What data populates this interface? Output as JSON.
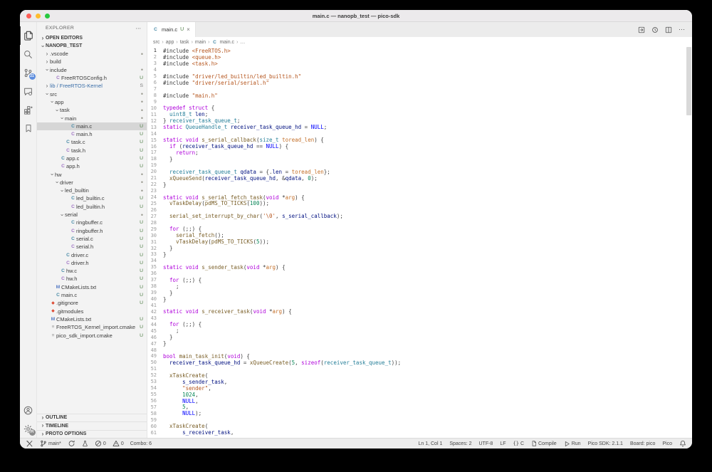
{
  "colors": {
    "keyword": "#AF00DB",
    "type": "#267F99",
    "function": "#795E26",
    "variable": "#001080",
    "string": "#B5551D",
    "number": "#098658",
    "constant": "#0000FF",
    "parameter": "#C4702A",
    "default": "#3B3B3B",
    "badge_untracked": "#518048",
    "badge_blue": "#2E6FD9",
    "icon_c_file": "#498BA7",
    "icon_h_file": "#A074C4",
    "icon_cmake": "#5277C3",
    "icon_git": "#DD4C35",
    "traffic_red": "#FF5F57",
    "traffic_yellow": "#FEBC2E",
    "traffic_green": "#28C840",
    "submodule_label": "#3A6EA8"
  },
  "window": {
    "title": "main.c — nanopb_test — pico-sdk"
  },
  "activity_bar": {
    "top": [
      {
        "icon": "explorer",
        "active": true
      },
      {
        "icon": "search",
        "active": false
      },
      {
        "icon": "source-control",
        "active": false,
        "badge": "21"
      },
      {
        "icon": "chat",
        "active": false
      },
      {
        "icon": "extensions",
        "active": false
      },
      {
        "icon": "bookmarks",
        "active": false
      }
    ],
    "bottom": [
      {
        "icon": "account"
      },
      {
        "icon": "settings",
        "badge": "PI"
      }
    ]
  },
  "sidebar": {
    "title": "EXPLORER",
    "more_label": "⋯",
    "open_editors_label": "OPEN EDITORS",
    "root_label": "NANOPB_TEST",
    "tree": [
      {
        "d": 0,
        "folder": true,
        "open": false,
        "label": ".vscode",
        "badge": "dot"
      },
      {
        "d": 0,
        "folder": true,
        "open": false,
        "label": "build",
        "badge": ""
      },
      {
        "d": 0,
        "folder": true,
        "open": true,
        "label": "include",
        "badge": "dot"
      },
      {
        "d": 1,
        "icon": "h",
        "label": "FreeRTOSConfig.h",
        "badge": "U"
      },
      {
        "d": 0,
        "folder": true,
        "open": false,
        "label": "lib / FreeRTOS-Kernel",
        "badge": "S",
        "submodule": true
      },
      {
        "d": 0,
        "folder": true,
        "open": true,
        "label": "src",
        "badge": "dot"
      },
      {
        "d": 1,
        "folder": true,
        "open": true,
        "label": "app",
        "badge": "dot"
      },
      {
        "d": 2,
        "folder": true,
        "open": true,
        "label": "task",
        "badge": "dot"
      },
      {
        "d": 3,
        "folder": true,
        "open": true,
        "label": "main",
        "badge": "dot"
      },
      {
        "d": 4,
        "icon": "c",
        "label": "main.c",
        "badge": "U",
        "selected": true
      },
      {
        "d": 4,
        "icon": "h",
        "label": "main.h",
        "badge": "U"
      },
      {
        "d": 3,
        "icon": "c",
        "label": "task.c",
        "badge": "U"
      },
      {
        "d": 3,
        "icon": "h",
        "label": "task.h",
        "badge": "U"
      },
      {
        "d": 2,
        "icon": "c",
        "label": "app.c",
        "badge": "U"
      },
      {
        "d": 2,
        "icon": "h",
        "label": "app.h",
        "badge": "U"
      },
      {
        "d": 1,
        "folder": true,
        "open": true,
        "label": "hw",
        "badge": "dot"
      },
      {
        "d": 2,
        "folder": true,
        "open": true,
        "label": "driver",
        "badge": "dot"
      },
      {
        "d": 3,
        "folder": true,
        "open": true,
        "label": "led_builtin",
        "badge": "dot"
      },
      {
        "d": 4,
        "icon": "c",
        "label": "led_builtin.c",
        "badge": "U"
      },
      {
        "d": 4,
        "icon": "h",
        "label": "led_builtin.h",
        "badge": "U"
      },
      {
        "d": 3,
        "folder": true,
        "open": true,
        "label": "serial",
        "badge": "dot"
      },
      {
        "d": 4,
        "icon": "c",
        "label": "ringbuffer.c",
        "badge": "U"
      },
      {
        "d": 4,
        "icon": "h",
        "label": "ringbuffer.h",
        "badge": "U"
      },
      {
        "d": 4,
        "icon": "c",
        "label": "serial.c",
        "badge": "U"
      },
      {
        "d": 4,
        "icon": "h",
        "label": "serial.h",
        "badge": "U"
      },
      {
        "d": 3,
        "icon": "c",
        "label": "driver.c",
        "badge": "U"
      },
      {
        "d": 3,
        "icon": "h",
        "label": "driver.h",
        "badge": "U"
      },
      {
        "d": 2,
        "icon": "c",
        "label": "hw.c",
        "badge": "U"
      },
      {
        "d": 2,
        "icon": "h",
        "label": "hw.h",
        "badge": "U"
      },
      {
        "d": 1,
        "icon": "m",
        "label": "CMakeLists.txt",
        "badge": "U"
      },
      {
        "d": 1,
        "icon": "c",
        "label": "main.c",
        "badge": "U"
      },
      {
        "d": 0,
        "icon": "git",
        "label": ".gitignore",
        "badge": "U"
      },
      {
        "d": 0,
        "icon": "git",
        "label": ".gitmodules",
        "badge": ""
      },
      {
        "d": 0,
        "icon": "m",
        "label": "CMakeLists.txt",
        "badge": "U"
      },
      {
        "d": 0,
        "icon": "cmake",
        "label": "FreeRTOS_Kernel_import.cmake",
        "badge": "U"
      },
      {
        "d": 0,
        "icon": "cmake",
        "label": "pico_sdk_import.cmake",
        "badge": "U"
      }
    ],
    "panels": [
      "OUTLINE",
      "TIMELINE",
      "PROTO OPTIONS"
    ]
  },
  "editor": {
    "tab": {
      "label": "main.c",
      "git_badge": "U",
      "close_label": "×"
    },
    "breadcrumb": [
      "src",
      "app",
      "task",
      "main",
      "main.c",
      "…"
    ],
    "lines": [
      [
        [
          "d",
          "#include "
        ],
        [
          "s",
          "<FreeRTOS.h>"
        ]
      ],
      [
        [
          "d",
          "#include "
        ],
        [
          "s",
          "<queue.h>"
        ]
      ],
      [
        [
          "d",
          "#include "
        ],
        [
          "s",
          "<task.h>"
        ]
      ],
      [],
      [
        [
          "d",
          "#include "
        ],
        [
          "s",
          "\"driver/led_builtin/led_builtin.h\""
        ]
      ],
      [
        [
          "d",
          "#include "
        ],
        [
          "s",
          "\"driver/serial/serial.h\""
        ]
      ],
      [],
      [
        [
          "d",
          "#include "
        ],
        [
          "s",
          "\"main.h\""
        ]
      ],
      [],
      [
        [
          "k",
          "typedef"
        ],
        [
          "d",
          " "
        ],
        [
          "k",
          "struct"
        ],
        [
          "d",
          " {"
        ]
      ],
      [
        [
          "d",
          "  "
        ],
        [
          "t",
          "uint8_t"
        ],
        [
          "d",
          " "
        ],
        [
          "v",
          "len"
        ],
        [
          "d",
          ";"
        ]
      ],
      [
        [
          "d",
          "} "
        ],
        [
          "t",
          "receiver_task_queue_t"
        ],
        [
          "d",
          ";"
        ]
      ],
      [
        [
          "k",
          "static"
        ],
        [
          "d",
          " "
        ],
        [
          "t",
          "QueueHandle_t"
        ],
        [
          "d",
          " "
        ],
        [
          "v",
          "receiver_task_queue_hd"
        ],
        [
          "d",
          " = "
        ],
        [
          "c",
          "NULL"
        ],
        [
          "d",
          ";"
        ]
      ],
      [],
      [
        [
          "k",
          "static"
        ],
        [
          "d",
          " "
        ],
        [
          "k",
          "void"
        ],
        [
          "d",
          " "
        ],
        [
          "f",
          "s_serial_callback"
        ],
        [
          "d",
          "("
        ],
        [
          "t",
          "size_t"
        ],
        [
          "d",
          " "
        ],
        [
          "p",
          "toread_len"
        ],
        [
          "d",
          ") {"
        ]
      ],
      [
        [
          "d",
          "  "
        ],
        [
          "k",
          "if"
        ],
        [
          "d",
          " ("
        ],
        [
          "v",
          "receiver_task_queue_hd"
        ],
        [
          "d",
          " == "
        ],
        [
          "c",
          "NULL"
        ],
        [
          "d",
          ") {"
        ]
      ],
      [
        [
          "d",
          "    "
        ],
        [
          "k",
          "return"
        ],
        [
          "d",
          ";"
        ]
      ],
      [
        [
          "d",
          "  }"
        ]
      ],
      [],
      [
        [
          "d",
          "  "
        ],
        [
          "t",
          "receiver_task_queue_t"
        ],
        [
          "d",
          " "
        ],
        [
          "v",
          "qdata"
        ],
        [
          "d",
          " = {."
        ],
        [
          "v",
          "len"
        ],
        [
          "d",
          " = "
        ],
        [
          "p",
          "toread_len"
        ],
        [
          "d",
          "};"
        ]
      ],
      [
        [
          "d",
          "  "
        ],
        [
          "f",
          "xQueueSend"
        ],
        [
          "d",
          "("
        ],
        [
          "v",
          "receiver_task_queue_hd"
        ],
        [
          "d",
          ", &"
        ],
        [
          "v",
          "qdata"
        ],
        [
          "d",
          ", "
        ],
        [
          "n",
          "0"
        ],
        [
          "d",
          ");"
        ]
      ],
      [
        [
          "d",
          "}"
        ]
      ],
      [],
      [
        [
          "k",
          "static"
        ],
        [
          "d",
          " "
        ],
        [
          "k",
          "void"
        ],
        [
          "d",
          " "
        ],
        [
          "f",
          "s_serial_fetch_task"
        ],
        [
          "d",
          "("
        ],
        [
          "k",
          "void"
        ],
        [
          "d",
          " *"
        ],
        [
          "p",
          "arg"
        ],
        [
          "d",
          ") {"
        ]
      ],
      [
        [
          "d",
          "  "
        ],
        [
          "f",
          "vTaskDelay"
        ],
        [
          "d",
          "("
        ],
        [
          "f",
          "pdMS_TO_TICKS"
        ],
        [
          "d",
          "("
        ],
        [
          "n",
          "100"
        ],
        [
          "d",
          "));"
        ]
      ],
      [],
      [
        [
          "d",
          "  "
        ],
        [
          "f",
          "serial_set_interrupt_by_char"
        ],
        [
          "d",
          "("
        ],
        [
          "s",
          "'\\0'"
        ],
        [
          "d",
          ", "
        ],
        [
          "v",
          "s_serial_callback"
        ],
        [
          "d",
          ");"
        ]
      ],
      [],
      [
        [
          "d",
          "  "
        ],
        [
          "k",
          "for"
        ],
        [
          "d",
          " (;;) {"
        ]
      ],
      [
        [
          "d",
          "    "
        ],
        [
          "f",
          "serial_fetch"
        ],
        [
          "d",
          "();"
        ]
      ],
      [
        [
          "d",
          "    "
        ],
        [
          "f",
          "vTaskDelay"
        ],
        [
          "d",
          "("
        ],
        [
          "f",
          "pdMS_TO_TICKS"
        ],
        [
          "d",
          "("
        ],
        [
          "n",
          "5"
        ],
        [
          "d",
          "));"
        ]
      ],
      [
        [
          "d",
          "  }"
        ]
      ],
      [
        [
          "d",
          "}"
        ]
      ],
      [],
      [
        [
          "k",
          "static"
        ],
        [
          "d",
          " "
        ],
        [
          "k",
          "void"
        ],
        [
          "d",
          " "
        ],
        [
          "f",
          "s_sender_task"
        ],
        [
          "d",
          "("
        ],
        [
          "k",
          "void"
        ],
        [
          "d",
          " *"
        ],
        [
          "p",
          "arg"
        ],
        [
          "d",
          ") {"
        ]
      ],
      [],
      [
        [
          "d",
          "  "
        ],
        [
          "k",
          "for"
        ],
        [
          "d",
          " (;;) {"
        ]
      ],
      [
        [
          "d",
          "    ;"
        ]
      ],
      [
        [
          "d",
          "  }"
        ]
      ],
      [
        [
          "d",
          "}"
        ]
      ],
      [],
      [
        [
          "k",
          "static"
        ],
        [
          "d",
          " "
        ],
        [
          "k",
          "void"
        ],
        [
          "d",
          " "
        ],
        [
          "f",
          "s_receiver_task"
        ],
        [
          "d",
          "("
        ],
        [
          "k",
          "void"
        ],
        [
          "d",
          " *"
        ],
        [
          "p",
          "arg"
        ],
        [
          "d",
          ") {"
        ]
      ],
      [],
      [
        [
          "d",
          "  "
        ],
        [
          "k",
          "for"
        ],
        [
          "d",
          " (;;) {"
        ]
      ],
      [
        [
          "d",
          "    ;"
        ]
      ],
      [
        [
          "d",
          "  }"
        ]
      ],
      [
        [
          "d",
          "}"
        ]
      ],
      [],
      [
        [
          "k",
          "bool"
        ],
        [
          "d",
          " "
        ],
        [
          "f",
          "main_task_init"
        ],
        [
          "d",
          "("
        ],
        [
          "k",
          "void"
        ],
        [
          "d",
          ") {"
        ]
      ],
      [
        [
          "d",
          "  "
        ],
        [
          "v",
          "receiver_task_queue_hd"
        ],
        [
          "d",
          " = "
        ],
        [
          "f",
          "xQueueCreate"
        ],
        [
          "d",
          "("
        ],
        [
          "n",
          "5"
        ],
        [
          "d",
          ", "
        ],
        [
          "k",
          "sizeof"
        ],
        [
          "d",
          "("
        ],
        [
          "t",
          "receiver_task_queue_t"
        ],
        [
          "d",
          "));"
        ]
      ],
      [],
      [
        [
          "d",
          "  "
        ],
        [
          "f",
          "xTaskCreate"
        ],
        [
          "d",
          "("
        ]
      ],
      [
        [
          "d",
          "      "
        ],
        [
          "v",
          "s_sender_task"
        ],
        [
          "d",
          ","
        ]
      ],
      [
        [
          "d",
          "      "
        ],
        [
          "s",
          "\"sender\""
        ],
        [
          "d",
          ","
        ]
      ],
      [
        [
          "d",
          "      "
        ],
        [
          "n",
          "1024"
        ],
        [
          "d",
          ","
        ]
      ],
      [
        [
          "d",
          "      "
        ],
        [
          "c",
          "NULL"
        ],
        [
          "d",
          ","
        ]
      ],
      [
        [
          "d",
          "      "
        ],
        [
          "n",
          "5"
        ],
        [
          "d",
          ","
        ]
      ],
      [
        [
          "d",
          "      "
        ],
        [
          "c",
          "NULL"
        ],
        [
          "d",
          ");"
        ]
      ],
      [],
      [
        [
          "d",
          "  "
        ],
        [
          "f",
          "xTaskCreate"
        ],
        [
          "d",
          "("
        ]
      ],
      [
        [
          "d",
          "      "
        ],
        [
          "v",
          "s_receiver_task"
        ],
        [
          "d",
          ","
        ]
      ]
    ]
  },
  "status_bar": {
    "left": [
      {
        "icon": "tools"
      },
      {
        "icon": "branch",
        "text": "main*"
      },
      {
        "icon": "sync"
      },
      {
        "icon": "flask"
      },
      {
        "icon": "error",
        "text": "0"
      },
      {
        "icon": "warning",
        "text": "0"
      },
      {
        "text": "Combo: 6"
      }
    ],
    "right": [
      {
        "text": "Ln 1, Col 1"
      },
      {
        "text": "Spaces: 2"
      },
      {
        "text": "UTF-8"
      },
      {
        "text": "LF"
      },
      {
        "icon": "braces",
        "text": "C"
      },
      {
        "icon": "file",
        "text": "Compile"
      },
      {
        "icon": "play",
        "text": "Run"
      },
      {
        "text": "Pico SDK: 2.1.1"
      },
      {
        "text": "Board: pico"
      },
      {
        "text": "Pico"
      },
      {
        "icon": "bell"
      }
    ]
  }
}
